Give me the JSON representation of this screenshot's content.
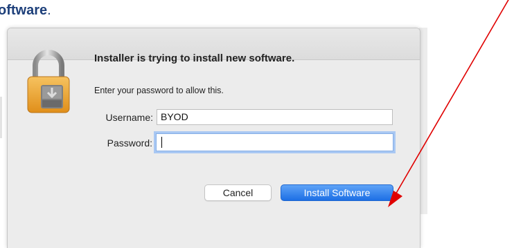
{
  "document": {
    "heading_bold": "oftware",
    "heading_tail": "."
  },
  "dialog": {
    "title": "Installer is trying to install new software.",
    "subtitle": "Enter your password to allow this.",
    "username_label": "Username:",
    "username_value": "BYOD",
    "password_label": "Password:",
    "password_value": "",
    "cancel_label": "Cancel",
    "install_label": "Install Software",
    "icon": "lock-icon",
    "accent_color": "#1c6fe5"
  },
  "annotation": {
    "arrow_color": "#e00000"
  }
}
